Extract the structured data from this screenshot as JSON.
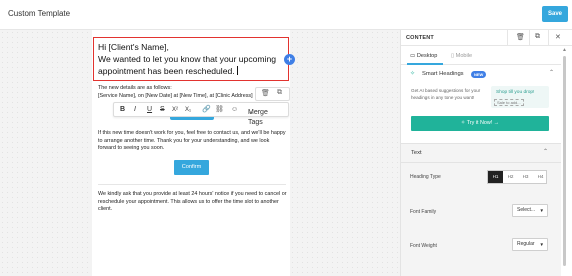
{
  "header": {
    "title": "Custom Template",
    "save_label": "Save"
  },
  "email": {
    "greeting_line1": "Hi [Client's Name],",
    "greeting_line2": "We wanted to let you know that your upcoming appointment has been rescheduled.",
    "details_line1": "The new details are as follows:",
    "details_line2": "[Service Name], on [New Date] at [New Time], at [Clinic Address]",
    "toolbar": {
      "bold": "B",
      "italic": "I",
      "underline": "U",
      "strike": "S",
      "superscript": "X²",
      "subscript": "X₁",
      "merge_tags": "Merge Tags"
    },
    "para2": "If this new time doesn't work for you, feel free to contact us, and we'll be happy to arrange another time. Thank you for your understanding, and we look forward to seeing you soon.",
    "confirm_label": "Confirm",
    "para3": "We kindly ask that you provide at least 24 hours' notice if you need to cancel or reschedule your appointment. This allows us to offer the time slot to another client."
  },
  "panel": {
    "title": "CONTENT",
    "devices": {
      "desktop": "Desktop",
      "mobile": "Mobile"
    },
    "smart_headings": {
      "title": "Smart Headings",
      "badge": "NEW",
      "description": "Get AI based suggestions for your headings in any tone you want!",
      "illustration_title": "Shop till you drop!",
      "illustration_sub": "Sale to add...",
      "try_label": "Try it Now!"
    },
    "text_section": {
      "title": "Text",
      "heading_type_label": "Heading Type",
      "heading_options": [
        "H1",
        "H2",
        "H3",
        "H4"
      ],
      "heading_selected": "H1",
      "font_family_label": "Font Family",
      "font_family_value": "Select...",
      "font_weight_label": "Font Weight",
      "font_weight_value": "Regular"
    }
  },
  "colors": {
    "accent": "#35a7dd",
    "selection": "#e2332f",
    "ai_green": "#20b39a",
    "badge_blue": "#3f7fe6"
  }
}
